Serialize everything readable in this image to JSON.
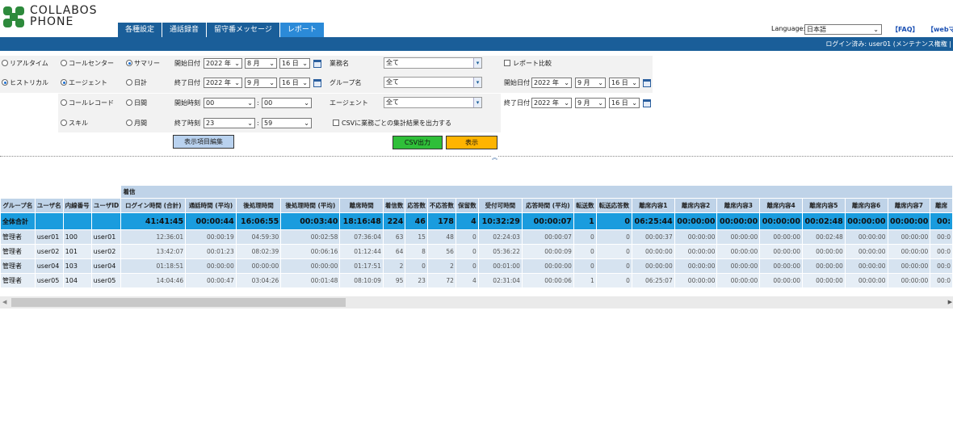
{
  "brand": {
    "line1": "COLLABOS",
    "line2": "PHONE"
  },
  "tabs": [
    "各種設定",
    "通話録音",
    "留守番メッセージ",
    "レポート"
  ],
  "active_tab": "レポート",
  "language": {
    "label": "Language:",
    "value": "日本語"
  },
  "links": {
    "faq": "【FAQ】",
    "web": "【webマ"
  },
  "login_status": "ログイン済み: user01 (メンテナンス権権 |",
  "report_types": {
    "realtime": "リアルタイム",
    "historical": "ヒストリカル"
  },
  "report_targets": {
    "call_center": "コールセンター",
    "agent": "エージェント",
    "call_record": "コールレコード",
    "skill": "スキル"
  },
  "periods": {
    "summary": "サマリー",
    "daily": "日計",
    "hourly": "日間",
    "monthly": "月間"
  },
  "filters": {
    "start_date_label": "開始日付",
    "end_date_label": "終了日付",
    "start_time_label": "開始時刻",
    "end_time_label": "終了時刻",
    "start_year": "2022 年",
    "start_month": "8 月",
    "start_day": "16 日",
    "end_year": "2022 年",
    "end_month": "9 月",
    "end_day": "16 日",
    "start_hour": "00",
    "start_minute": "00",
    "end_hour": "23",
    "end_minute": "59",
    "colon": ":",
    "business_label": "業務名",
    "business_value": "全て",
    "group_label": "グループ名",
    "group_value": "全て",
    "agent_label": "エージェント",
    "agent_value": "全て",
    "csv_option": "CSVに業務ごとの集計結果を出力する",
    "compare_label": "レポート比較",
    "cmp_start_label": "開始日付",
    "cmp_end_label": "終了日付",
    "cmp_start_year": "2022 年",
    "cmp_start_month": "9 月",
    "cmp_start_day": "16 日",
    "cmp_end_year": "2022 年",
    "cmp_end_month": "9 月",
    "cmp_end_day": "16 日"
  },
  "buttons": {
    "edit_columns": "表示項目編集",
    "csv": "CSV出力",
    "show": "表示"
  },
  "colors": {
    "header_bar": "#1a5e99",
    "total_row": "#1a9cde",
    "csv_btn": "#2fbf39",
    "show_btn": "#ffb400"
  },
  "table": {
    "group_header": "着信",
    "columns": [
      "グループ名",
      "ユーザ名",
      "内線番号",
      "ユーザID",
      "ログイン時間 (合計)",
      "通話時間 (平均)",
      "後処理時間",
      "後処理時間 (平均)",
      "離席時間",
      "着信数",
      "応答数",
      "不応答数",
      "保留数",
      "受付可時間",
      "応答時間 (平均)",
      "転送数",
      "転送応答数",
      "離席内容1",
      "離席内容2",
      "離席内容3",
      "離席内容4",
      "離席内容5",
      "離席内容6",
      "離席内容7",
      "離席"
    ],
    "total": [
      "全体合計",
      "",
      "",
      "",
      "41:41:45",
      "00:00:44",
      "16:06:55",
      "00:03:40",
      "18:16:48",
      "224",
      "46",
      "178",
      "4",
      "10:32:29",
      "00:00:07",
      "1",
      "0",
      "06:25:44",
      "00:00:00",
      "00:00:00",
      "00:00:00",
      "00:02:48",
      "00:00:00",
      "00:00:00",
      "00:"
    ],
    "rows": [
      [
        "管理者",
        "user01",
        "100",
        "user01",
        "12:36:01",
        "00:00:19",
        "04:59:30",
        "00:02:58",
        "07:36:04",
        "63",
        "15",
        "48",
        "0",
        "02:24:03",
        "00:00:07",
        "0",
        "0",
        "00:00:37",
        "00:00:00",
        "00:00:00",
        "00:00:00",
        "00:02:48",
        "00:00:00",
        "00:00:00",
        "00:0"
      ],
      [
        "管理者",
        "user02",
        "101",
        "user02",
        "13:42:07",
        "00:01:23",
        "08:02:39",
        "00:06:16",
        "01:12:44",
        "64",
        "8",
        "56",
        "0",
        "05:36:22",
        "00:00:09",
        "0",
        "0",
        "00:00:00",
        "00:00:00",
        "00:00:00",
        "00:00:00",
        "00:00:00",
        "00:00:00",
        "00:00:00",
        "00:0"
      ],
      [
        "管理者",
        "user04",
        "103",
        "user04",
        "01:18:51",
        "00:00:00",
        "00:00:00",
        "00:00:00",
        "01:17:51",
        "2",
        "0",
        "2",
        "0",
        "00:01:00",
        "00:00:00",
        "0",
        "0",
        "00:00:00",
        "00:00:00",
        "00:00:00",
        "00:00:00",
        "00:00:00",
        "00:00:00",
        "00:00:00",
        "00:0"
      ],
      [
        "管理者",
        "user05",
        "104",
        "user05",
        "14:04:46",
        "00:00:47",
        "03:04:26",
        "00:01:48",
        "08:10:09",
        "95",
        "23",
        "72",
        "4",
        "02:31:04",
        "00:00:06",
        "1",
        "0",
        "06:25:07",
        "00:00:00",
        "00:00:00",
        "00:00:00",
        "00:00:00",
        "00:00:00",
        "00:00:00",
        "00:0"
      ]
    ]
  }
}
